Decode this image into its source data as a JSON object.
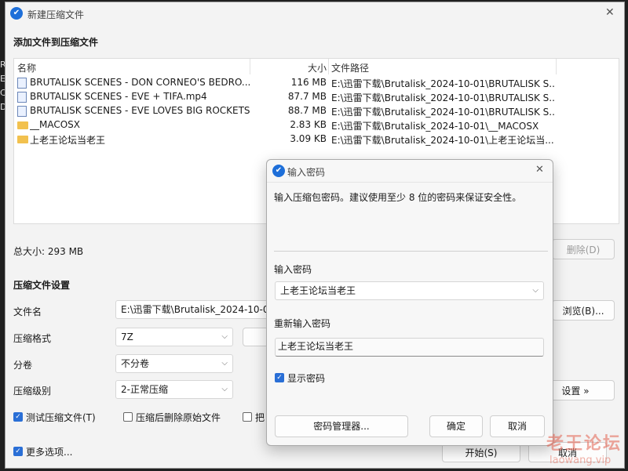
{
  "window": {
    "title": "新建压缩文件",
    "close": "✕"
  },
  "section_add": "添加文件到压缩文件",
  "file_list": {
    "headers": {
      "name": "名称",
      "size": "大小",
      "path": "文件路径"
    },
    "rows": [
      {
        "type": "file",
        "name": "BRUTALISK SCENES - DON CORNEO'S BEDRO...",
        "size": "116 MB",
        "path": "E:\\迅雷下载\\Brutalisk_2024-10-01\\BRUTALISK S..."
      },
      {
        "type": "file",
        "name": "BRUTALISK SCENES - EVE + TIFA.mp4",
        "size": "87.7 MB",
        "path": "E:\\迅雷下载\\Brutalisk_2024-10-01\\BRUTALISK S..."
      },
      {
        "type": "file",
        "name": "BRUTALISK SCENES - EVE LOVES BIG ROCKETS....",
        "size": "88.7 MB",
        "path": "E:\\迅雷下载\\Brutalisk_2024-10-01\\BRUTALISK S..."
      },
      {
        "type": "folder",
        "name": "__MACOSX",
        "size": "2.83 KB",
        "path": "E:\\迅雷下载\\Brutalisk_2024-10-01\\__MACOSX"
      },
      {
        "type": "folder",
        "name": "上老王论坛当老王",
        "size": "3.09 KB",
        "path": "E:\\迅雷下载\\Brutalisk_2024-10-01\\上老王论坛当..."
      }
    ]
  },
  "total_size": "总大小: 293 MB",
  "delete_button": "删除(D)",
  "settings": {
    "heading": "压缩文件设置",
    "filename_label": "文件名",
    "filename_value": "E:\\迅雷下载\\Brutalisk_2024-10-01",
    "browse_button": "浏览(B)...",
    "format_label": "压缩格式",
    "format_value": "7Z",
    "split_label": "分卷",
    "split_value": "不分卷",
    "level_label": "压缩级别",
    "level_value": "2-正常压缩",
    "advanced_button": "设置 »"
  },
  "options": {
    "test": "测试压缩文件(T)",
    "delete_after": "压缩后删除原始文件",
    "truncated": "把"
  },
  "more_options": "更多选项...",
  "start_button": "开始(S)",
  "cancel_button": "取消",
  "password_dialog": {
    "title": "输入密码",
    "close": "✕",
    "description": "输入压缩包密码。建议使用至少 8 位的密码来保证安全性。",
    "enter_label": "输入密码",
    "enter_value": "上老王论坛当老王",
    "reenter_label": "重新输入密码",
    "reenter_value": "上老王论坛当老王",
    "show_password": "显示密码",
    "manager_button": "密码管理器...",
    "ok_button": "确定",
    "cancel_button": "取消"
  },
  "background_edge_text": [
    "R",
    "E",
    "C",
    "D"
  ],
  "watermark": {
    "text": "老王论坛",
    "url": "laowang.vip"
  },
  "icons": {
    "check": "✓",
    "chevron": "⌵",
    "app": "✔"
  },
  "colors": {
    "accent": "#2a6fd6",
    "folder": "#f2c14e",
    "watermark": "#e3614f"
  }
}
